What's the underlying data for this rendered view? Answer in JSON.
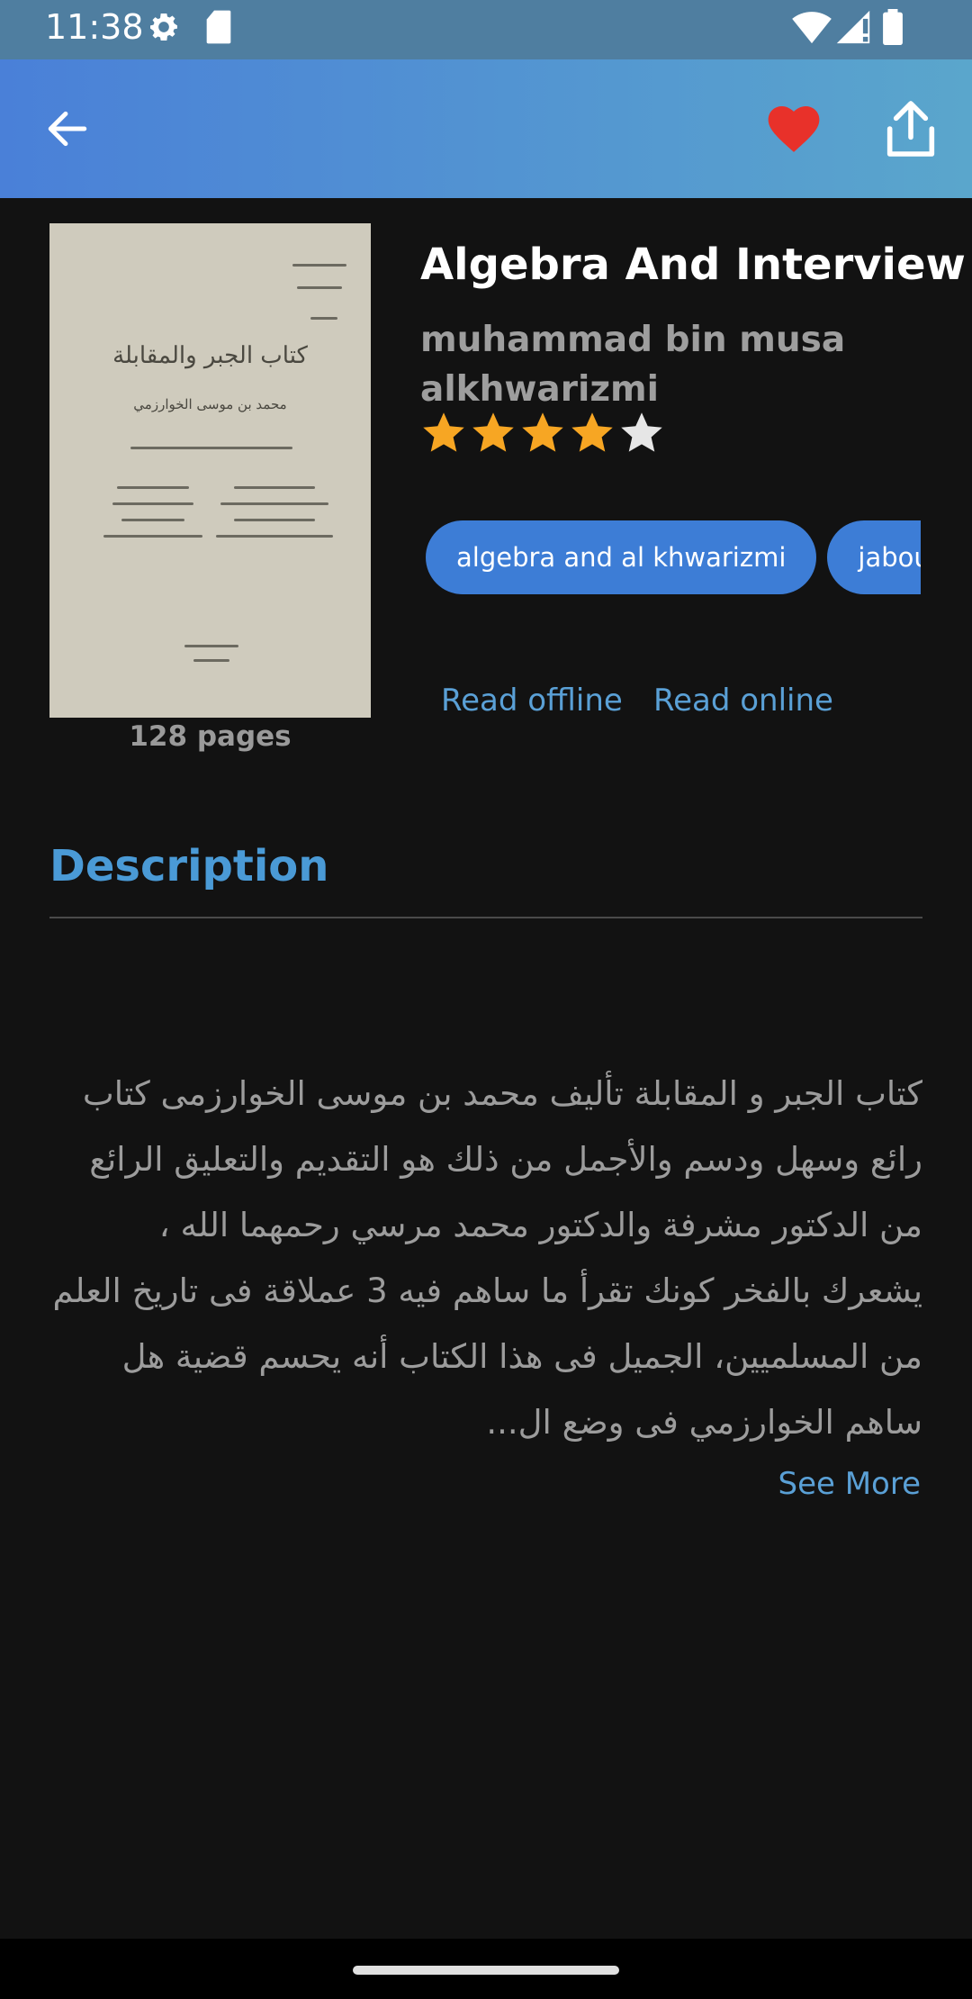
{
  "status_bar": {
    "time": "11:38",
    "icons": [
      "gear-icon",
      "sd-card-icon",
      "wifi-icon",
      "signal-icon",
      "battery-icon"
    ]
  },
  "app_bar": {
    "back_icon": "arrow-left-icon",
    "favorite_icon": "heart-icon",
    "share_icon": "share-icon",
    "colors": {
      "gradient_start": "#4a80d8",
      "gradient_end": "#5aa6cc",
      "favorite": "#e8312a"
    }
  },
  "book": {
    "cover_lines": [
      "كتاب الجبر والمقابلة",
      "محمد بن موسى الخوارزمي"
    ],
    "pages_label": "128 pages",
    "title": "Algebra And Interview",
    "author": "muhammad bin musa alkhwarizmi",
    "rating": 4,
    "rating_max": 5,
    "tags": [
      "algebra and al khwarizmi",
      "jabour ..."
    ],
    "read_offline": "Read offline",
    "read_online": "Read online"
  },
  "description": {
    "heading": "Description",
    "text": "كتاب الجبر و المقابلة تأليف محمد بن موسى الخوارزمى كتاب رائع وسهل ودسم والأجمل من ذلك هو التقديم والتعليق الرائع من الدكتور مشرفة والدكتور محمد مرسي رحمهما الله ، يشعرك بالفخر كونك تقرأ ما ساهم فيه 3 عملاقة فى تاريخ العلم من المسلميين، الجميل فى هذا الكتاب أنه يحسم قضية هل ساهم الخوارزمي فى وضع ال...",
    "see_more": "See More"
  },
  "colors": {
    "accent": "#5aa0d6",
    "star_filled": "#f7a623",
    "star_empty": "#e6e6e6",
    "tag_bg": "#3d7dd6"
  }
}
